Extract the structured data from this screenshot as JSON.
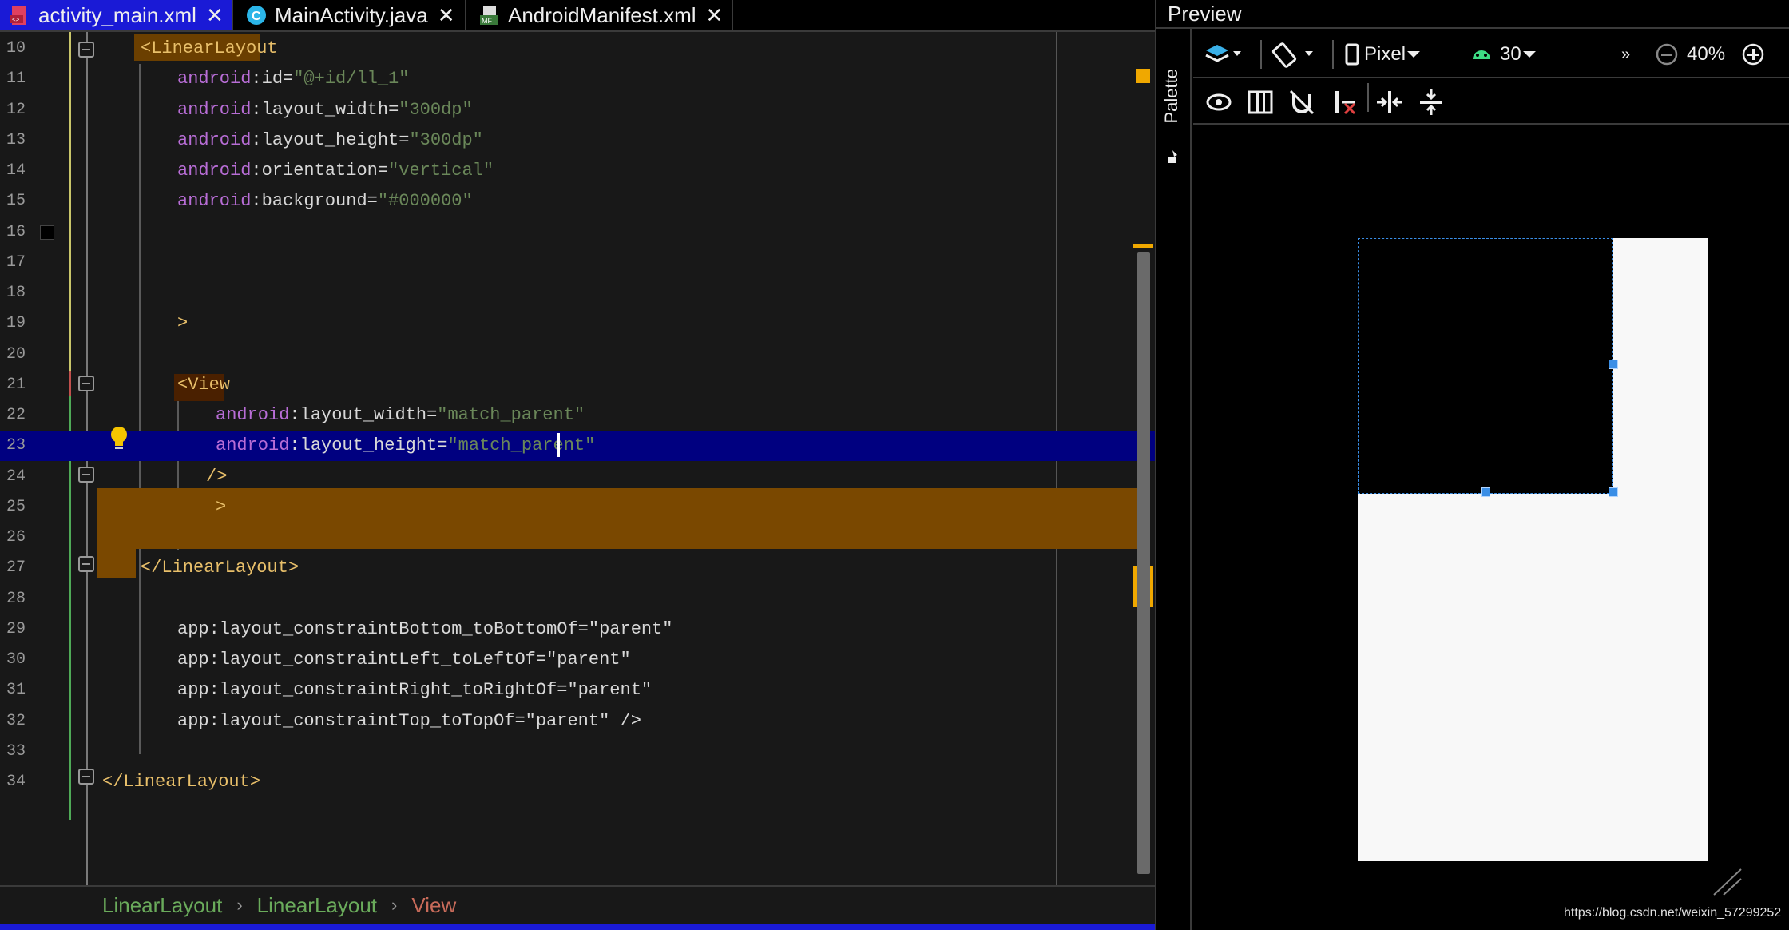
{
  "tabs": [
    {
      "label": "activity_main.xml",
      "icon": "xml-layout-icon",
      "active": true
    },
    {
      "label": "MainActivity.java",
      "icon": "class-c-icon",
      "active": false
    },
    {
      "label": "AndroidManifest.xml",
      "icon": "manifest-icon",
      "active": false
    }
  ],
  "editor": {
    "lines": [
      {
        "num": "10",
        "parts": [
          [
            "tag",
            "<LinearLayout"
          ]
        ]
      },
      {
        "num": "11",
        "parts": [
          [
            "ns",
            "android"
          ],
          [
            "attr",
            ":id"
          ],
          [
            "eq",
            "="
          ],
          [
            "str",
            "\"@+id/ll_1\""
          ]
        ]
      },
      {
        "num": "12",
        "parts": [
          [
            "ns",
            "android"
          ],
          [
            "attr",
            ":layout_width"
          ],
          [
            "eq",
            "="
          ],
          [
            "str",
            "\"300dp\""
          ]
        ]
      },
      {
        "num": "13",
        "parts": [
          [
            "ns",
            "android"
          ],
          [
            "attr",
            ":layout_height"
          ],
          [
            "eq",
            "="
          ],
          [
            "str",
            "\"300dp\""
          ]
        ]
      },
      {
        "num": "14",
        "parts": [
          [
            "ns",
            "android"
          ],
          [
            "attr",
            ":orientation"
          ],
          [
            "eq",
            "="
          ],
          [
            "str",
            "\"vertical\""
          ]
        ]
      },
      {
        "num": "15",
        "parts": [
          [
            "ns",
            "android"
          ],
          [
            "attr",
            ":background"
          ],
          [
            "eq",
            "="
          ],
          [
            "str",
            "\"#000000\""
          ]
        ]
      },
      {
        "num": "16",
        "parts": []
      },
      {
        "num": "17",
        "parts": []
      },
      {
        "num": "18",
        "parts": []
      },
      {
        "num": "19",
        "parts": [
          [
            "tag",
            ">"
          ]
        ]
      },
      {
        "num": "20",
        "parts": []
      },
      {
        "num": "21",
        "parts": [
          [
            "tag",
            "<View"
          ]
        ]
      },
      {
        "num": "22",
        "parts": [
          [
            "ns",
            "android"
          ],
          [
            "attr",
            ":layout_width"
          ],
          [
            "eq",
            "="
          ],
          [
            "str",
            "\"match_parent\""
          ]
        ]
      },
      {
        "num": "23",
        "parts": [
          [
            "ns",
            "android"
          ],
          [
            "attr",
            ":layout_height"
          ],
          [
            "eq",
            "="
          ],
          [
            "str",
            "\"match_parent\""
          ]
        ]
      },
      {
        "num": "24",
        "parts": [
          [
            "tag",
            "/>"
          ]
        ]
      },
      {
        "num": "25",
        "parts": [
          [
            "tag",
            ">"
          ]
        ]
      },
      {
        "num": "26",
        "parts": []
      },
      {
        "num": "27",
        "parts": [
          [
            "tag",
            "</LinearLayout>"
          ]
        ]
      },
      {
        "num": "28",
        "parts": []
      },
      {
        "num": "29",
        "parts": [
          [
            "plain",
            "app:layout_constraintBottom_toBottomOf=\"parent\""
          ]
        ]
      },
      {
        "num": "30",
        "parts": [
          [
            "plain",
            "app:layout_constraintLeft_toLeftOf=\"parent\""
          ]
        ]
      },
      {
        "num": "31",
        "parts": [
          [
            "plain",
            "app:layout_constraintRight_toRightOf=\"parent\""
          ]
        ]
      },
      {
        "num": "32",
        "parts": [
          [
            "plain",
            "app:layout_constraintTop_toTopOf=\"parent\" />"
          ]
        ]
      },
      {
        "num": "33",
        "parts": []
      },
      {
        "num": "34",
        "parts": [
          [
            "tag",
            "</LinearLayout>"
          ]
        ]
      }
    ]
  },
  "breadcrumb": [
    "LinearLayout",
    "LinearLayout",
    "View"
  ],
  "preview": {
    "title": "Preview",
    "palette_label": "Palette",
    "device": "Pixel",
    "api_level": "30",
    "overflow": "»",
    "zoom": "40%",
    "watermark": "https://blog.csdn.net/weixin_57299252"
  },
  "colors": {
    "accent_tab": "#1a1ad6",
    "current_line": "#000080",
    "highlight_block": "#7a4800",
    "selection_outline": "#3a8ee6"
  }
}
